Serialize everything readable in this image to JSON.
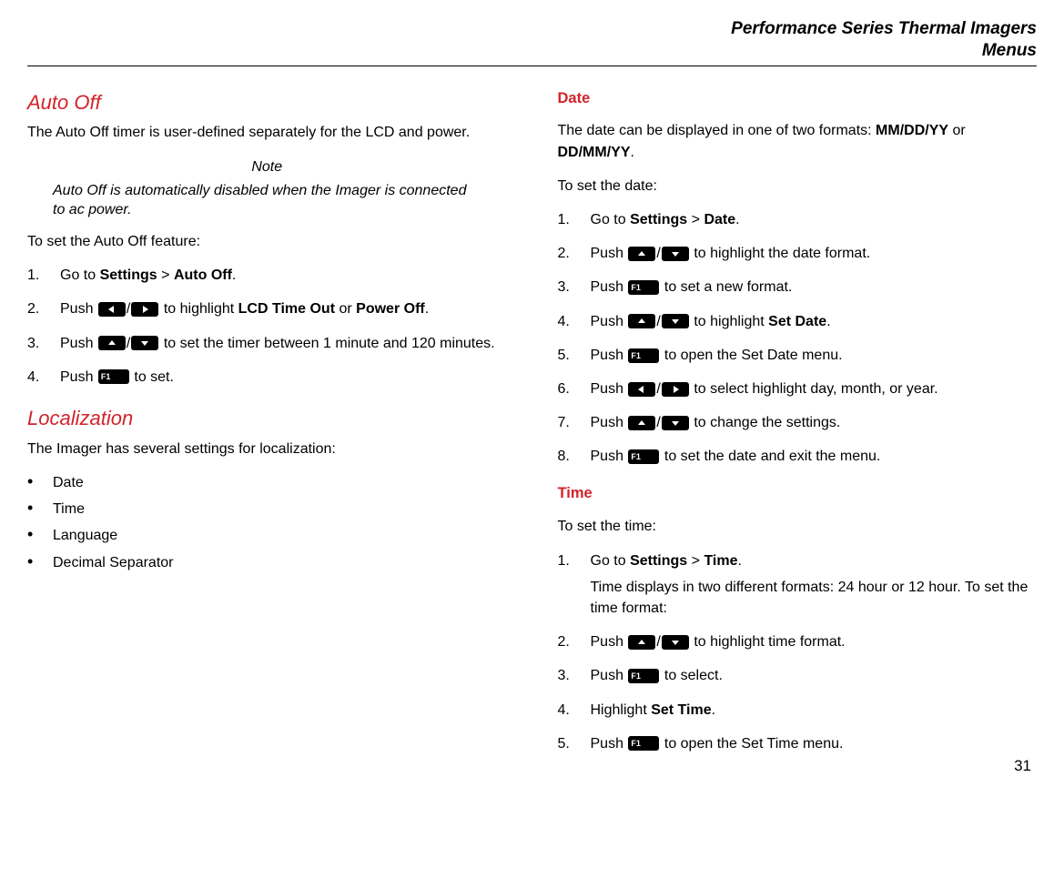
{
  "header": {
    "line1": "Performance Series Thermal Imagers",
    "line2": "Menus"
  },
  "page_number": "31",
  "left": {
    "auto_off": {
      "title": "Auto Off",
      "intro": "The Auto Off timer is user-defined separately for the LCD and power.",
      "note_label": "Note",
      "note_body": "Auto Off is automatically disabled when the Imager is connected to ac power.",
      "lead_in": "To set the Auto Off feature:",
      "steps": {
        "s1_pre": "Go to ",
        "s1_b1": "Settings",
        "s1_gt": " > ",
        "s1_b2": "Auto Off",
        "s1_post": ".",
        "s2_pre": "Push ",
        "s2_mid": " to highlight ",
        "s2_b1": "LCD Time Out",
        "s2_or": " or ",
        "s2_b2": "Power Off",
        "s2_post": ".",
        "s3_pre": "Push ",
        "s3_post": " to set the timer between 1 minute and 120 minutes.",
        "s4_pre": "Push ",
        "s4_post": " to set."
      }
    },
    "localization": {
      "title": "Localization",
      "intro": "The Imager has several settings for localization:",
      "items": [
        "Date",
        "Time",
        "Language",
        "Decimal Separator"
      ]
    }
  },
  "right": {
    "date": {
      "title": "Date",
      "intro_pre": "The date can be displayed in one of two formats: ",
      "fmt1": "MM/DD/YY",
      "or": " or ",
      "fmt2": "DD/MM/YY",
      "intro_post": ".",
      "lead_in": "To set the date:",
      "steps": {
        "s1_pre": "Go to ",
        "s1_b1": "Settings",
        "s1_gt": " > ",
        "s1_b2": "Date",
        "s1_post": ".",
        "s2_pre": "Push ",
        "s2_post": " to highlight the date format.",
        "s3_pre": "Push ",
        "s3_post": " to set a new format.",
        "s4_pre": "Push ",
        "s4_mid": " to highlight ",
        "s4_b": "Set Date",
        "s4_post": ".",
        "s5_pre": "Push ",
        "s5_post": " to open the Set Date menu.",
        "s6_pre": "Push ",
        "s6_post": " to select highlight day, month, or year.",
        "s7_pre": "Push ",
        "s7_post": " to change the settings.",
        "s8_pre": "Push ",
        "s8_post": " to set the date and exit the menu."
      }
    },
    "time": {
      "title": "Time",
      "lead_in": "To set the time:",
      "steps": {
        "s1_pre": "Go to ",
        "s1_b1": "Settings",
        "s1_gt": " > ",
        "s1_b2": "Time",
        "s1_post": ".",
        "s1_sub": "Time displays in two different formats: 24 hour or 12 hour. To set the time format:",
        "s2_pre": "Push ",
        "s2_post": " to highlight time format.",
        "s3_pre": "Push ",
        "s3_post": " to select.",
        "s4_pre": "Highlight ",
        "s4_b": "Set Time",
        "s4_post": ".",
        "s5_pre": "Push ",
        "s5_post": " to open the Set Time menu."
      }
    }
  },
  "labels": {
    "f1": "F1",
    "slash": "/"
  }
}
